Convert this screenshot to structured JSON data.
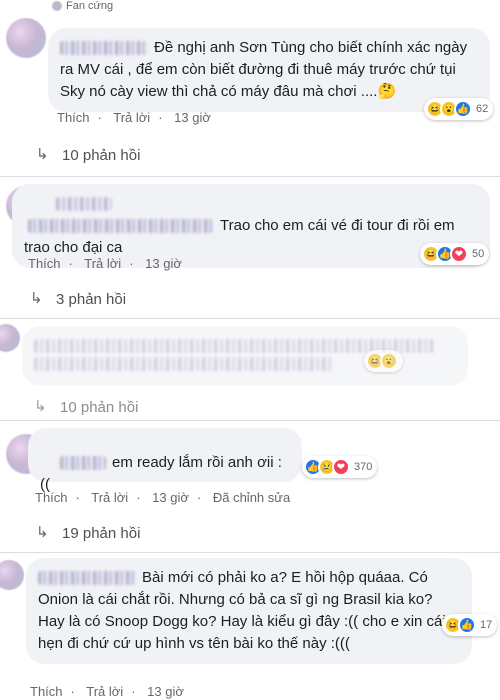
{
  "comments": [
    {
      "top_label": "Fan cứng",
      "text": "Đề nghị anh Sơn Tùng cho biết chính xác ngày ra MV cái , để em còn biết đường đi thuê máy trước chứ tụi Sky nó cày view thì chả có máy đâu mà chơi ....🤔",
      "actions": {
        "like": "Thích",
        "reply": "Trả lời",
        "time": "13 giờ"
      },
      "reactions": {
        "icons": [
          "haha-icon",
          "wow-icon",
          "like-icon"
        ],
        "count": "62"
      },
      "replies": "10 phản hồi"
    },
    {
      "text": "Trao cho em cái vé đi tour đi rồi em trao cho đại ca",
      "actions": {
        "like": "Thích",
        "reply": "Trả lời",
        "time": "13 giờ"
      },
      "reactions": {
        "icons": [
          "haha-icon",
          "like-icon",
          "love-icon"
        ],
        "count": "50"
      },
      "replies": "3 phản hồi"
    },
    {
      "text": "",
      "actions": {},
      "reactions": {
        "icons": [
          "haha-icon",
          "wow-icon"
        ],
        "count": ""
      },
      "replies": "10 phản hồi"
    },
    {
      "text": "em ready lắm rồi anh ơii :((",
      "actions": {
        "like": "Thích",
        "reply": "Trả lời",
        "time": "13 giờ",
        "edited": "Đã chỉnh sửa"
      },
      "reactions": {
        "icons": [
          "like-icon",
          "sad-icon",
          "love-icon"
        ],
        "count": "370"
      },
      "replies": "19 phản hồi"
    },
    {
      "text": "Bài mới có phải ko a? E hồi hộp quáaa. Có Onion là cái chắt rồi. Nhưng có bả ca sĩ gì ng Brasil kia ko? Hay là có Snoop Dogg ko? Hay là kiểu gì đây :(( cho e xin cái hẹn đi chứ cứ up hình vs tên bài ko thế này :(((",
      "actions": {
        "like": "Thích",
        "reply": "Trả lời",
        "time": "13 giờ"
      },
      "reactions": {
        "icons": [
          "haha-icon",
          "like-icon"
        ],
        "count": "17"
      }
    }
  ],
  "colors": {
    "bubble": "#f0f2f5",
    "meta": "#65676b",
    "like": "#1877f2",
    "haha": "#f7c531",
    "love": "#f33e58"
  }
}
